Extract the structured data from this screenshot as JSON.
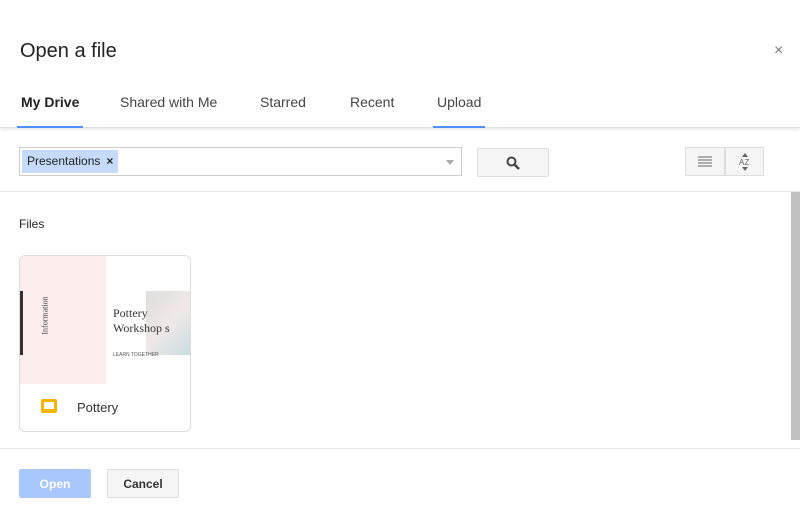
{
  "dialog": {
    "title": "Open a file",
    "close_label": "×"
  },
  "tabs": [
    {
      "label": "My Drive"
    },
    {
      "label": "Shared with Me"
    },
    {
      "label": "Starred"
    },
    {
      "label": "Recent"
    },
    {
      "label": "Upload"
    }
  ],
  "search": {
    "chip": "Presentations",
    "chip_remove": "×"
  },
  "section": {
    "files_label": "Files"
  },
  "files": [
    {
      "name": "Pottery",
      "thumb_side": "Information",
      "thumb_title": "Pottery Workshop s",
      "thumb_sub": "LEARN TOGETHER"
    }
  ],
  "footer": {
    "open_label": "Open",
    "cancel_label": "Cancel"
  },
  "colors": {
    "accent": "#4d90fe",
    "chip": "#c6dafc",
    "open_disabled": "#a8c7fa",
    "slides": "#f4b400"
  }
}
